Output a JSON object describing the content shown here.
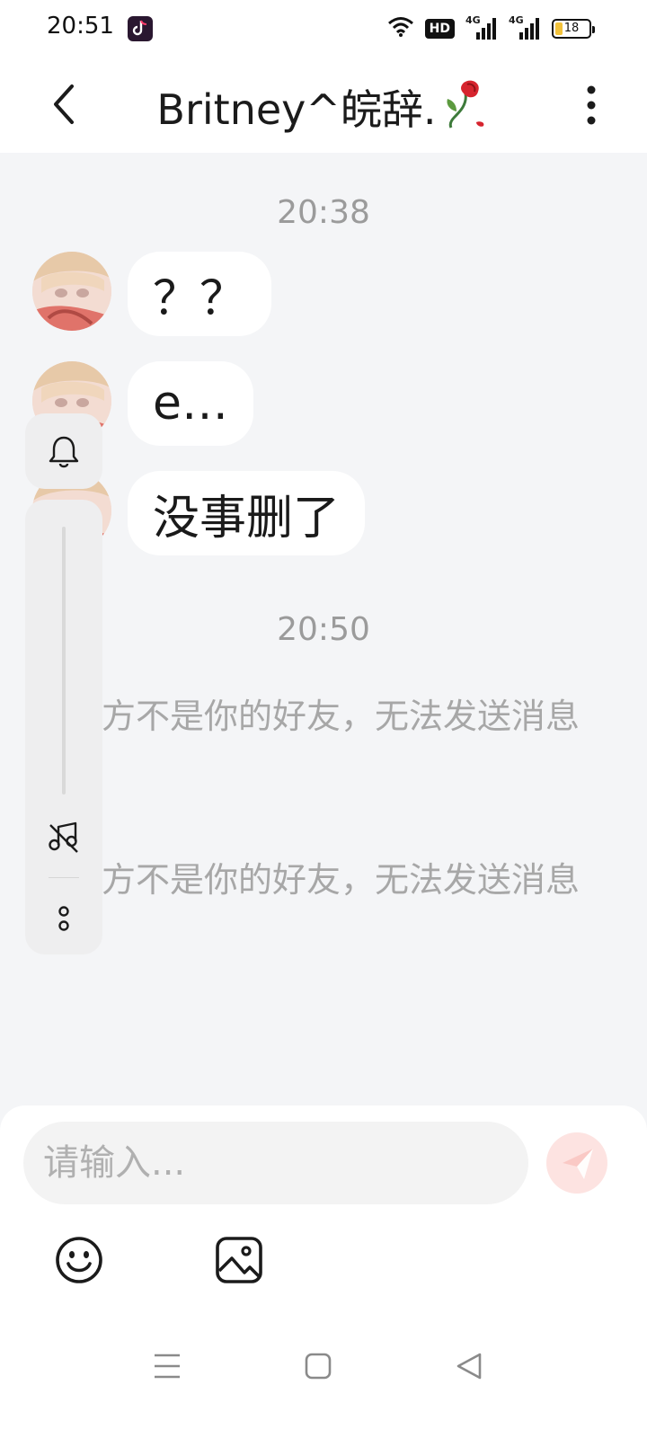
{
  "status_bar": {
    "time": "20:51",
    "network_labels": [
      "4G",
      "4G"
    ],
    "hd_label": "HD",
    "battery_level": "18"
  },
  "header": {
    "title": "Britney^皖辞."
  },
  "messages": {
    "timestamp_1": "20:38",
    "msg_1": "？？",
    "msg_2": "e…",
    "msg_3": "没事删了",
    "timestamp_2": "20:50",
    "system_1": "对方不是你的好友，无法发送消息",
    "system_2": "对方不是你的好友，无法发送消息"
  },
  "composer": {
    "placeholder": "请输入...",
    "value": ""
  },
  "colors": {
    "background": "#f4f5f7",
    "send_button": "#fde3e1",
    "send_icon": "#f6a7a0",
    "system_text": "#a7a7a7"
  },
  "icons": {
    "back": "back-arrow-icon",
    "more": "more-vertical-icon",
    "bell": "bell-icon",
    "music_off": "music-off-icon",
    "float_more": "more-vertical-icon",
    "send": "send-plane-icon",
    "emoji": "emoji-icon",
    "image": "image-icon",
    "nav_menu": "menu-icon",
    "nav_home": "home-square-icon",
    "nav_back": "back-triangle-icon"
  }
}
